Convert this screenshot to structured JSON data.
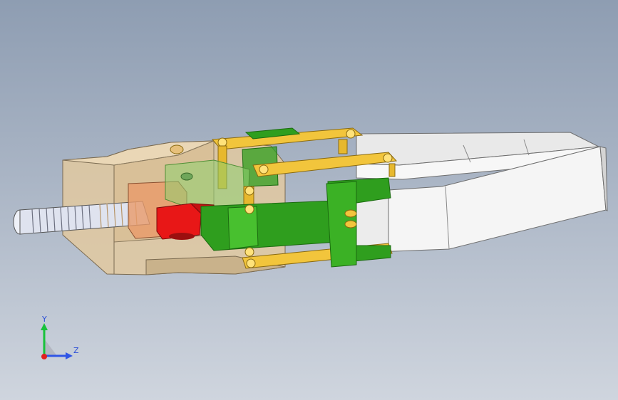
{
  "viewport": {
    "background_top": "#8e9db2",
    "background_bottom": "#cfd5de"
  },
  "colors": {
    "housing": "#e2c9a0",
    "housing_dark": "#b9a07a",
    "jaw": "#f3f3f3",
    "jaw_shade": "#d8d8d8",
    "link_gold": "#f2c53c",
    "link_gold_dark": "#b98f17",
    "green": "#2f9e1e",
    "green_dark": "#1b6a10",
    "red": "#e81717",
    "screw": "#dfe3ef"
  },
  "triad": {
    "y_label": "Y",
    "z_label": "Z",
    "y_color": "#18c23a",
    "z_color": "#2f55e6",
    "x_color": "#e01f1f"
  }
}
